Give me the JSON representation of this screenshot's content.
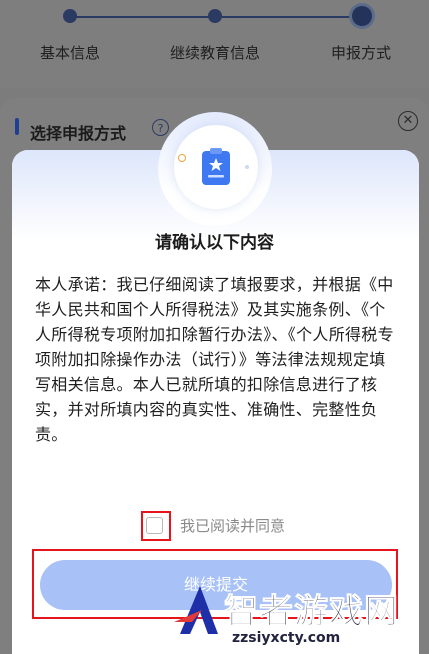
{
  "steps": [
    {
      "label": "基本信息"
    },
    {
      "label": "继续教育信息"
    },
    {
      "label": "申报方式"
    }
  ],
  "background": {
    "section_title": "选择申报方式",
    "help_icon": "question-circle-icon",
    "close_icon": "close-circle-icon"
  },
  "modal": {
    "icon": "document-star-icon",
    "title": "请确认以下内容",
    "body": "本人承诺：我已仔细阅读了填报要求，并根据《中华人民共和国个人所得税法》及其实施条例、《个人所得税专项附加扣除暂行办法》、《个人所得税专项附加扣除操作办法（试行）》等法律法规规定填写相关信息。本人已就所填的扣除信息进行了核实，并对所填内容的真实性、准确性、完整性负责。",
    "agree_label": "我已阅读并同意",
    "agree_checked": false,
    "submit_label": "继续提交"
  },
  "watermark": {
    "brand": "智者游戏网",
    "url": "zzsiyxcty.com"
  },
  "colors": {
    "accent": "#1e3f94",
    "button": "#a8c2f7",
    "highlight": "#e8141b"
  }
}
